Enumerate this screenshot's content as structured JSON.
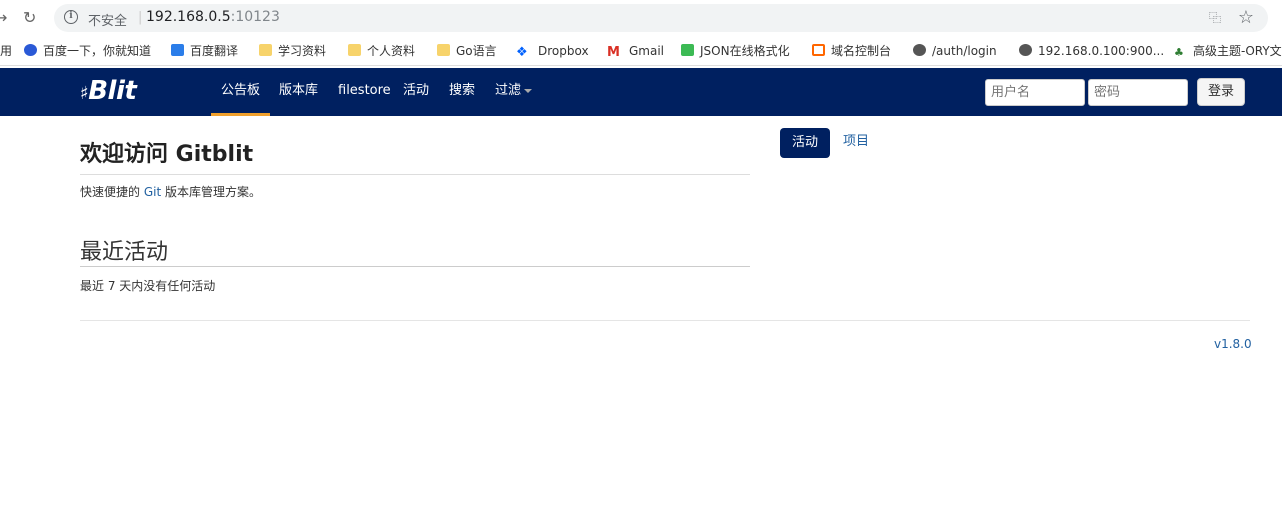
{
  "browser": {
    "security_label": "不安全",
    "url_host": "192.168.0.5",
    "url_port": ":10123",
    "bookmarks": [
      {
        "label": "用"
      },
      {
        "label": "百度一下，你就知道"
      },
      {
        "label": "百度翻译"
      },
      {
        "label": "学习资料"
      },
      {
        "label": "个人资料"
      },
      {
        "label": "Go语言"
      },
      {
        "label": "Dropbox"
      },
      {
        "label": "Gmail"
      },
      {
        "label": "JSON在线格式化"
      },
      {
        "label": "域名控制台"
      },
      {
        "label": "/auth/login"
      },
      {
        "label": "192.168.0.100:900..."
      },
      {
        "label": "高级主题-ORY文"
      }
    ]
  },
  "app": {
    "brand": "Blit",
    "nav": [
      {
        "label": "公告板"
      },
      {
        "label": "版本库"
      },
      {
        "label": "filestore"
      },
      {
        "label": "活动"
      },
      {
        "label": "搜索"
      },
      {
        "label": "过滤"
      }
    ],
    "login": {
      "username_placeholder": "用户名",
      "password_placeholder": "密码",
      "button": "登录"
    }
  },
  "main": {
    "title": "欢迎访问 Gitblit",
    "subtitle_pre": "快速便捷的 ",
    "subtitle_link": "Git",
    "subtitle_post": " 版本库管理方案。",
    "recent_title": "最近活动",
    "recent_empty": "最近 7 天内没有任何活动"
  },
  "side_tabs": {
    "active": "活动",
    "other": "项目"
  },
  "footer": {
    "version": "v1.8.0"
  },
  "colors": {
    "navbar": "#002060",
    "active_underline": "#f0a02c",
    "link": "#2261a1"
  }
}
